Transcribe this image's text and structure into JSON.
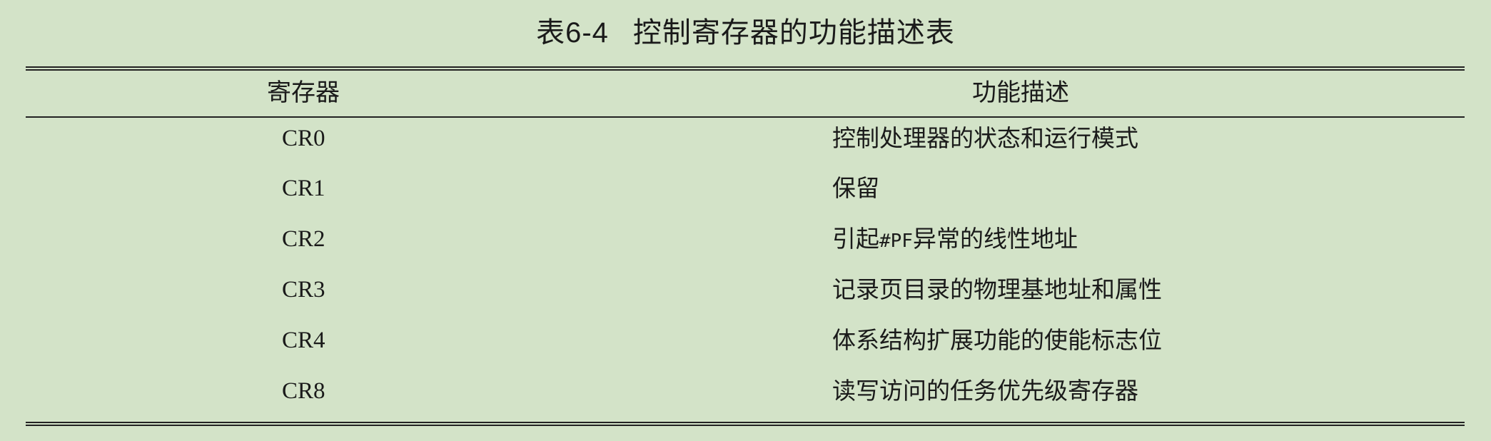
{
  "caption": {
    "number": "表6-4",
    "title": "控制寄存器的功能描述表"
  },
  "table": {
    "headers": {
      "register": "寄存器",
      "description": "功能描述"
    },
    "rows": [
      {
        "register": "CR0",
        "description": "控制处理器的状态和运行模式"
      },
      {
        "register": "CR1",
        "description": "保留"
      },
      {
        "register": "CR2",
        "description_pre": "引起",
        "description_code": "#PF",
        "description_post": "异常的线性地址"
      },
      {
        "register": "CR3",
        "description": "记录页目录的物理基地址和属性"
      },
      {
        "register": "CR4",
        "description": "体系结构扩展功能的使能标志位"
      },
      {
        "register": "CR8",
        "description": "读写访问的任务优先级寄存器"
      }
    ]
  }
}
